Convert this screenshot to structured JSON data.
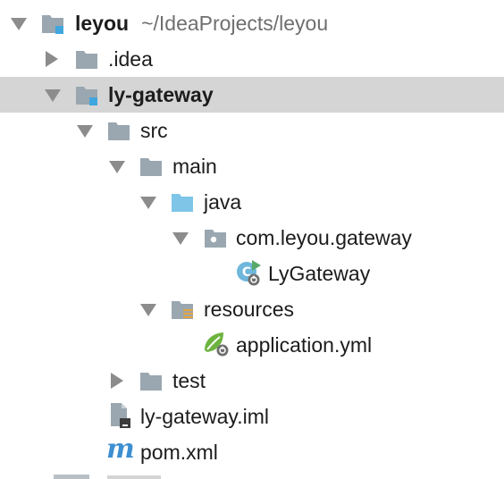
{
  "tree": {
    "root": {
      "name": "leyou",
      "path": "~/IdeaProjects/leyou"
    },
    "idea": {
      "name": ".idea"
    },
    "module": {
      "name": "ly-gateway"
    },
    "src": {
      "name": "src"
    },
    "main": {
      "name": "main"
    },
    "java": {
      "name": "java"
    },
    "package": {
      "name": "com.leyou.gateway"
    },
    "class": {
      "name": "LyGateway"
    },
    "resources": {
      "name": "resources"
    },
    "appyml": {
      "name": "application.yml"
    },
    "test": {
      "name": "test"
    },
    "iml": {
      "name": "ly-gateway.iml"
    },
    "pom": {
      "name": "pom.xml",
      "icon_letter": "m"
    }
  },
  "colors": {
    "folder": "#9aa7b0",
    "source_folder": "#7ec5e8",
    "module_badge": "#40a6e0",
    "selection": "#d5d5d5",
    "spring": "#6db33f",
    "maven": "#3d8fd1"
  }
}
